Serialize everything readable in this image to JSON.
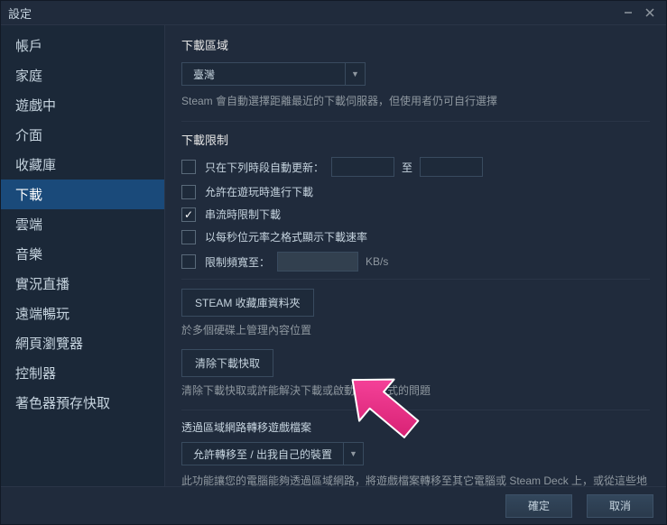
{
  "window": {
    "title": "設定"
  },
  "sidebar": {
    "items": [
      {
        "label": "帳戶"
      },
      {
        "label": "家庭"
      },
      {
        "label": "遊戲中"
      },
      {
        "label": "介面"
      },
      {
        "label": "收藏庫"
      },
      {
        "label": "下載",
        "selected": true
      },
      {
        "label": "雲端"
      },
      {
        "label": "音樂"
      },
      {
        "label": "實況直播"
      },
      {
        "label": "遠端暢玩"
      },
      {
        "label": "網頁瀏覽器"
      },
      {
        "label": "控制器"
      },
      {
        "label": "著色器預存快取"
      }
    ]
  },
  "region": {
    "heading": "下載區域",
    "selected": "臺灣",
    "hint": "Steam 會自動選擇距離最近的下載伺服器，但使用者仍可自行選擇"
  },
  "limits": {
    "heading": "下載限制",
    "schedule_label": "只在下列時段自動更新：",
    "to_label": "至",
    "allow_while_playing": "允許在遊玩時進行下載",
    "throttle_streaming": {
      "label": "串流時限制下載",
      "checked": true
    },
    "show_bits": "以每秒位元率之格式顯示下載速率",
    "bandwidth_label": "限制頻寬至：",
    "bandwidth_unit": "KB/s"
  },
  "library_folders": {
    "button": "STEAM 收藏庫資料夾",
    "desc": "於多個硬碟上管理內容位置"
  },
  "clear_cache": {
    "button": "清除下載快取",
    "desc": "清除下載快取或許能解決下載或啟動應用程式的問題"
  },
  "lan_transfer": {
    "heading": "透過區域網路轉移遊戲檔案",
    "selected": "允許轉移至 / 出我自己的裝置",
    "desc": "此功能讓您的電腦能夠透過區域網路，將遊戲檔案轉移至其它電腦或 Steam Deck 上，或從這些地方轉移檔案過來，降低下載或更新遊戲時的網路流量"
  },
  "footer": {
    "ok": "確定",
    "cancel": "取消"
  }
}
